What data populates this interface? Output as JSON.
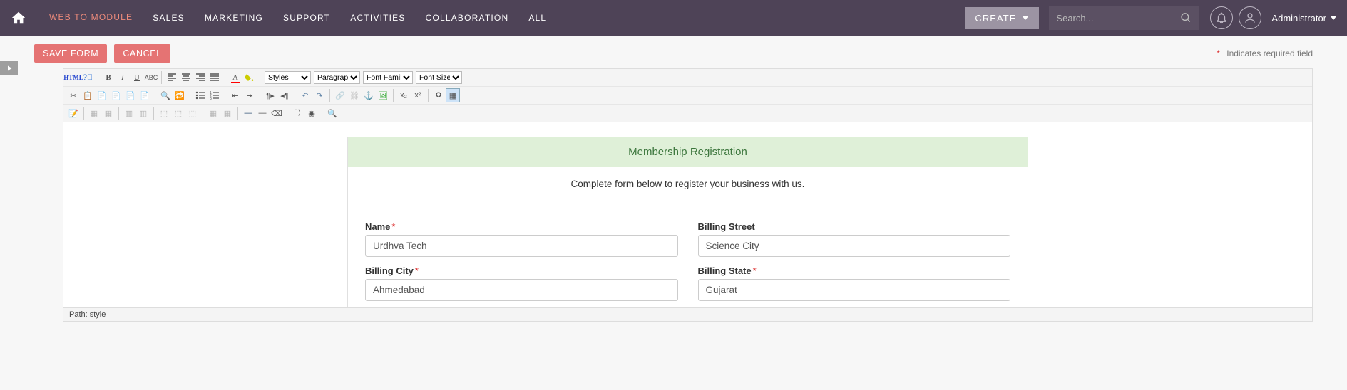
{
  "nav": {
    "items": [
      "WEB TO MODULE",
      "SALES",
      "MARKETING",
      "SUPPORT",
      "ACTIVITIES",
      "COLLABORATION",
      "ALL"
    ],
    "active_index": 0
  },
  "create_label": "CREATE",
  "search_placeholder": "Search...",
  "user_name": "Administrator",
  "actions": {
    "save": "SAVE FORM",
    "cancel": "CANCEL"
  },
  "required_note": "Indicates required field",
  "toolbar": {
    "html": "HTML",
    "styles": "Styles",
    "paragraph": "Paragraph",
    "font_family": "Font Family",
    "font_size": "Font Size"
  },
  "form": {
    "title": "Membership Registration",
    "subtitle": "Complete form below to register your business with us.",
    "fields": {
      "name": {
        "label": "Name",
        "required": true,
        "value": "Urdhva Tech"
      },
      "billing_street": {
        "label": "Billing Street",
        "required": false,
        "value": "Science City"
      },
      "billing_city": {
        "label": "Billing City",
        "required": true,
        "value": "Ahmedabad"
      },
      "billing_state": {
        "label": "Billing State",
        "required": true,
        "value": "Gujarat"
      }
    }
  },
  "path": "Path: style"
}
